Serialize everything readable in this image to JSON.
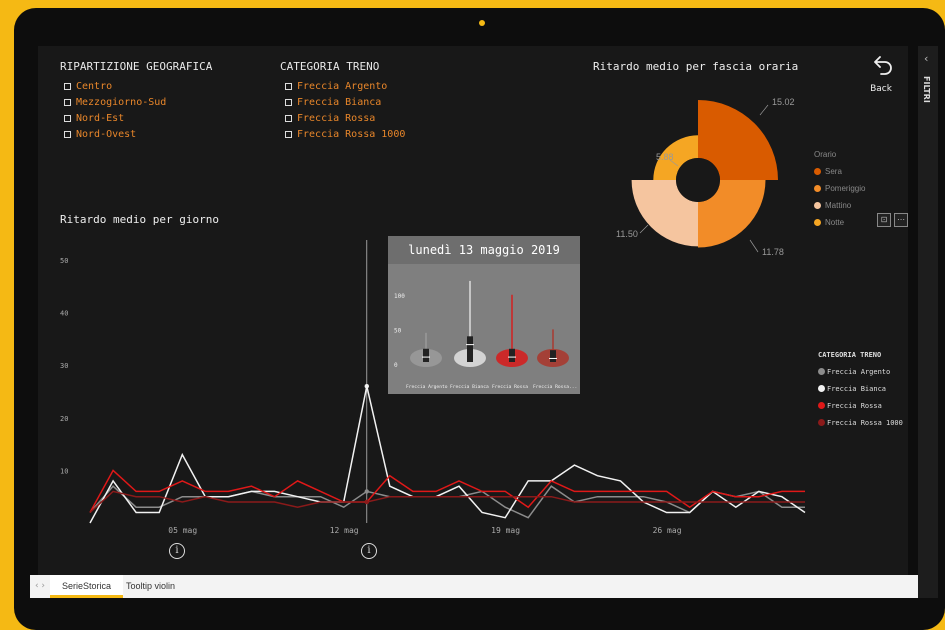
{
  "slicer_geo": {
    "title": "RIPARTIZIONE GEOGRAFICA",
    "items": [
      "Centro",
      "Mezzogiorno-Sud",
      "Nord-Est",
      "Nord-Ovest"
    ]
  },
  "slicer_cat": {
    "title": "CATEGORIA TRENO",
    "items": [
      "Freccia Argento",
      "Freccia Bianca",
      "Freccia Rossa",
      "Freccia Rossa 1000"
    ]
  },
  "donut": {
    "title": "Ritardo medio per fascia oraria",
    "legend_title": "Orario",
    "chart_data": {
      "type": "pie",
      "title": "Ritardo medio per fascia oraria",
      "slices": [
        {
          "label": "Sera",
          "value": 15.02,
          "color": "#D95B00"
        },
        {
          "label": "Pomeriggio",
          "value": 11.78,
          "color": "#F28C28"
        },
        {
          "label": "Mattino",
          "value": 11.5,
          "color": "#F5C59F"
        },
        {
          "label": "Notte",
          "value": 5.88,
          "color": "#F5A623"
        }
      ],
      "value_labels": [
        "15.02",
        "11.78",
        "11.50",
        "5.88"
      ]
    }
  },
  "back": {
    "label": "Back"
  },
  "line_chart": {
    "title": "Ritardo medio per giorno",
    "legend_title": "CATEGORIA TRENO",
    "chart_data": {
      "type": "line",
      "title": "Ritardo medio per giorno",
      "ylim": [
        0,
        50
      ],
      "y_ticks": [
        "50",
        "40",
        "30",
        "20",
        "10"
      ],
      "x_ticks": [
        "05 mag",
        "12 mag",
        "19 mag",
        "26 mag"
      ],
      "x_tick_index": [
        4,
        11,
        18,
        25
      ],
      "series": [
        {
          "name": "Freccia Argento",
          "color": "#8c8c8c",
          "values": [
            2,
            7,
            3,
            3,
            5,
            5,
            5,
            6,
            5,
            5,
            5,
            3,
            6,
            5,
            5,
            5,
            5,
            6,
            3,
            1,
            7,
            4,
            5,
            5,
            5,
            4,
            2,
            6,
            5,
            6,
            3,
            3
          ]
        },
        {
          "name": "Freccia Bianca",
          "color": "#f2f2f2",
          "values": [
            0,
            8,
            2,
            2,
            13,
            5,
            5,
            6,
            6,
            5,
            4,
            4,
            26,
            7,
            5,
            5,
            7,
            2,
            1,
            8,
            8,
            11,
            9,
            8,
            4,
            2,
            2,
            6,
            3,
            6,
            5,
            2
          ]
        },
        {
          "name": "Freccia Rossa",
          "color": "#e01818",
          "values": [
            2,
            10,
            6,
            6,
            8,
            6,
            6,
            7,
            5,
            8,
            6,
            4,
            4,
            9,
            6,
            6,
            8,
            6,
            6,
            3,
            8,
            6,
            6,
            6,
            6,
            6,
            3,
            6,
            5,
            5,
            6,
            6
          ]
        },
        {
          "name": "Freccia Rossa 1000",
          "color": "#8b1a1a",
          "values": [
            2,
            6,
            5,
            5,
            4,
            5,
            4,
            4,
            4,
            3,
            4,
            4,
            4,
            5,
            5,
            5,
            5,
            5,
            5,
            5,
            5,
            4,
            4,
            4,
            4,
            4,
            4,
            4,
            4,
            4,
            4,
            4
          ]
        }
      ]
    }
  },
  "tooltip": {
    "date": "lunedì 13 maggio 2019",
    "chart_data": {
      "type": "violin",
      "y_ticks": [
        "100",
        "50",
        "0"
      ],
      "categories": [
        "Freccia Argento",
        "Freccia Bianca",
        "Freccia Rossa",
        "Freccia Rossa..."
      ],
      "colors": [
        "#9a9a9a",
        "#dddddd",
        "#d42020",
        "#a83a30"
      ],
      "max": [
        45,
        120,
        100,
        50
      ],
      "median": [
        10,
        28,
        10,
        8
      ]
    }
  },
  "tabs": [
    "SerieStorica",
    "Tooltip violin"
  ],
  "side_panel": {
    "label": "FILTRI"
  }
}
